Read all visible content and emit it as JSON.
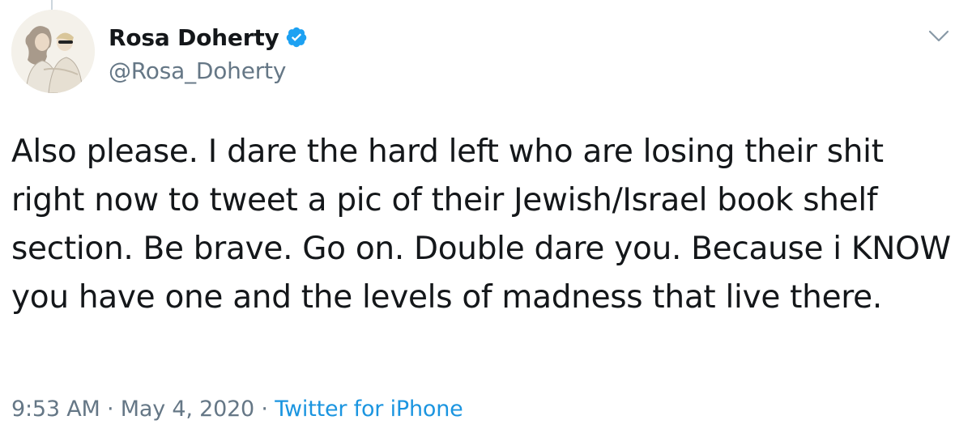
{
  "tweet": {
    "author_name": "Rosa Doherty",
    "handle": "@Rosa_Doherty",
    "verified": true,
    "text": "Also please. I dare the hard left who are losing their shit right now to tweet a pic of their Jewish/Israel book shelf section. Be brave. Go on. Double dare you. Because i KNOW you have one and the levels of madness that live there.",
    "time": "9:53 AM",
    "separator": "·",
    "date": "May 4, 2020",
    "source": "Twitter for iPhone"
  },
  "icons": {
    "verified": "verified-badge-icon",
    "menu": "chevron-down-icon"
  },
  "colors": {
    "accent": "#1da1f2",
    "link": "#1b95e0",
    "secondary_text": "#657786",
    "primary_text": "#14171a"
  }
}
